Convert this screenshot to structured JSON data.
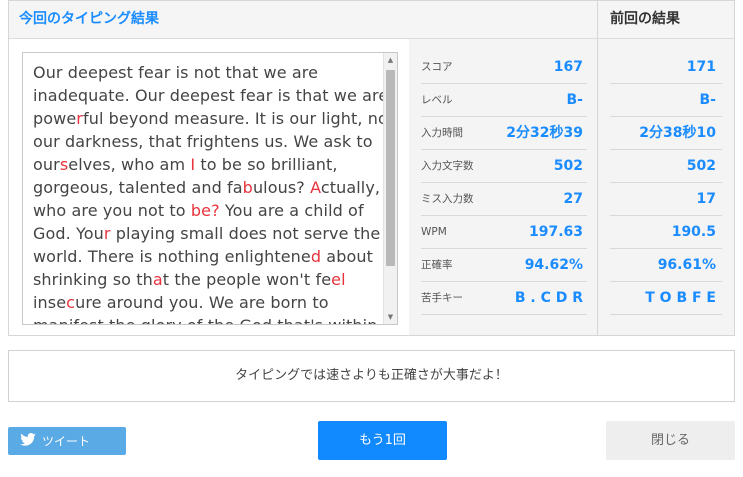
{
  "header": {
    "current_title": "今回のタイピング結果",
    "previous_title": "前回の結果"
  },
  "passage": {
    "lines": [
      [
        {
          "t": "Our deepest fear is not that we are"
        }
      ],
      [
        {
          "t": "inadequate. Our deepest fear is that we are"
        }
      ],
      [
        {
          "t": "powe"
        },
        {
          "t": "r",
          "m": true
        },
        {
          "t": "ful beyond measure. It is our light, not"
        }
      ],
      [
        {
          "t": "our darkness, that frightens us. We ask to"
        }
      ],
      [
        {
          "t": "our"
        },
        {
          "t": "s",
          "m": true
        },
        {
          "t": "elves, who am "
        },
        {
          "t": "I",
          "m": true
        },
        {
          "t": " to be so brilliant,"
        }
      ],
      [
        {
          "t": "gorgeous, talented and fa"
        },
        {
          "t": "b",
          "m": true
        },
        {
          "t": "ulous? "
        },
        {
          "t": "A",
          "m": true
        },
        {
          "t": "ctually,"
        }
      ],
      [
        {
          "t": "who are you not to "
        },
        {
          "t": "be?",
          "m": true
        },
        {
          "t": " You are a child of"
        }
      ],
      [
        {
          "t": "God. You"
        },
        {
          "t": "r",
          "m": true
        },
        {
          "t": " playing small does not serve the"
        }
      ],
      [
        {
          "t": "world. There is nothing enlightene"
        },
        {
          "t": "d",
          "m": true
        },
        {
          "t": " about"
        }
      ],
      [
        {
          "t": "shrinking so th"
        },
        {
          "t": "a",
          "m": true
        },
        {
          "t": "t the people won't fe"
        },
        {
          "t": "el",
          "m": true
        }
      ],
      [
        {
          "t": "inse"
        },
        {
          "t": "c",
          "m": true
        },
        {
          "t": "ure around you. We are born to"
        }
      ],
      [
        {
          "t": "manifest the glory of the God that's within"
        }
      ]
    ]
  },
  "stats": {
    "labels": [
      "スコア",
      "レベル",
      "入力時間",
      "入力文字数",
      "ミス入力数",
      "WPM",
      "正確率",
      "苦手キー"
    ],
    "current": [
      "167",
      "B-",
      "2分32秒39",
      "502",
      "27",
      "197.63",
      "94.62%",
      "B . C D R"
    ],
    "previous": [
      "171",
      "B-",
      "2分38秒10",
      "502",
      "17",
      "190.5",
      "96.61%",
      "T O B F E"
    ]
  },
  "message": "タイピングでは速さよりも正確さが大事だよ！",
  "buttons": {
    "tweet": "ツイート",
    "retry": "もう1回",
    "close": "閉じる"
  },
  "colors": {
    "accent": "#1a8cff",
    "miss": "#e8323c",
    "tweet": "#5aaae5",
    "retry": "#1189ff"
  }
}
